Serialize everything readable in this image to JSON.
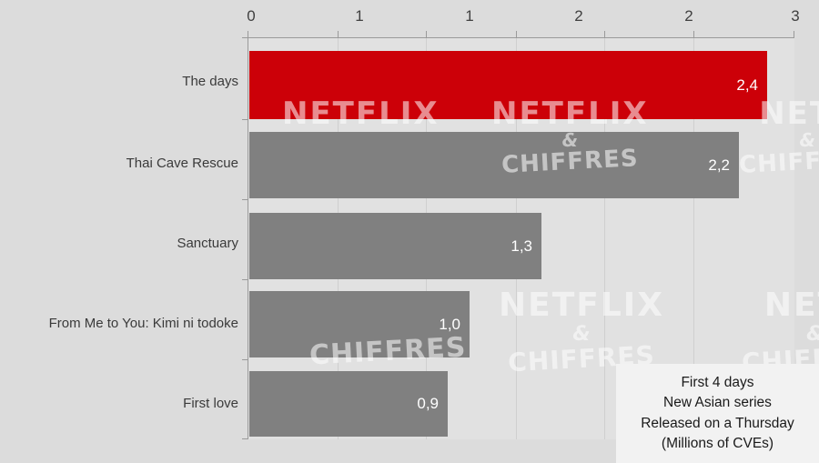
{
  "chart_data": {
    "type": "bar",
    "orientation": "horizontal",
    "title": "",
    "subtitle": "",
    "xlabel": "",
    "ylabel": "",
    "xlim": [
      0,
      3
    ],
    "grid": true,
    "legend_position": "bottom-right",
    "categories": [
      "The days",
      "Thai Cave Rescue",
      "Sanctuary",
      "From Me to You: Kimi ni todoke",
      "First love"
    ],
    "values": [
      2.4,
      2.2,
      1.3,
      1.0,
      0.9
    ],
    "value_labels": [
      "2,4",
      "2,2",
      "1,3",
      "1,0",
      "0,9"
    ],
    "bar_colors": [
      "#cc0008",
      "#808080",
      "#808080",
      "#808080",
      "#808080"
    ],
    "highlight_index": 0,
    "x_ticks": [
      0,
      0.5,
      1,
      1.5,
      2,
      2.5,
      3
    ],
    "x_tick_labels": [
      "0",
      "1",
      "1",
      "2",
      "2",
      "3"
    ],
    "x_tick_values": [
      0,
      0.5,
      1,
      1.5,
      2,
      2.5
    ],
    "axis_end_label": "3"
  },
  "colors": {
    "background": "#dcdcdc",
    "plot_background": "#e1e1e1",
    "highlight": "#cc0008",
    "bar": "#808080",
    "axis": "#9a9a9a",
    "gridline": "#cfcfcf",
    "value_text": "#ffffff",
    "label_text": "#3a3a3a",
    "caption_background": "#f2f2f2"
  },
  "axis": {
    "ticks": [
      {
        "label": "0",
        "value": 0
      },
      {
        "label": "1",
        "value": 0.5
      },
      {
        "label": "1",
        "value": 1
      },
      {
        "label": "2",
        "value": 1.5
      },
      {
        "label": "2",
        "value": 2
      },
      {
        "label": "3",
        "value": 2.5
      }
    ]
  },
  "bars": [
    {
      "label": "The days",
      "value": 2.4,
      "display": "2,4",
      "color": "highlight"
    },
    {
      "label": "Thai Cave Rescue",
      "value": 2.2,
      "display": "2,2",
      "color": "bar"
    },
    {
      "label": "Sanctuary",
      "value": 1.3,
      "display": "1,3",
      "color": "bar"
    },
    {
      "label": "From Me to You: Kimi ni todoke",
      "value": 1.0,
      "display": "1,0",
      "color": "bar"
    },
    {
      "label": "First love",
      "value": 0.9,
      "display": "0,9",
      "color": "bar"
    }
  ],
  "caption": {
    "lines": [
      "First 4 days",
      "New Asian series",
      "Released on a Thursday",
      "(Millions of CVEs)"
    ]
  },
  "watermark": {
    "top": "NETFLIX",
    "amp": "&",
    "bottom": "CHIFFRES",
    "short_top": "NETF",
    "short_bottom": "CHIFFRES"
  }
}
